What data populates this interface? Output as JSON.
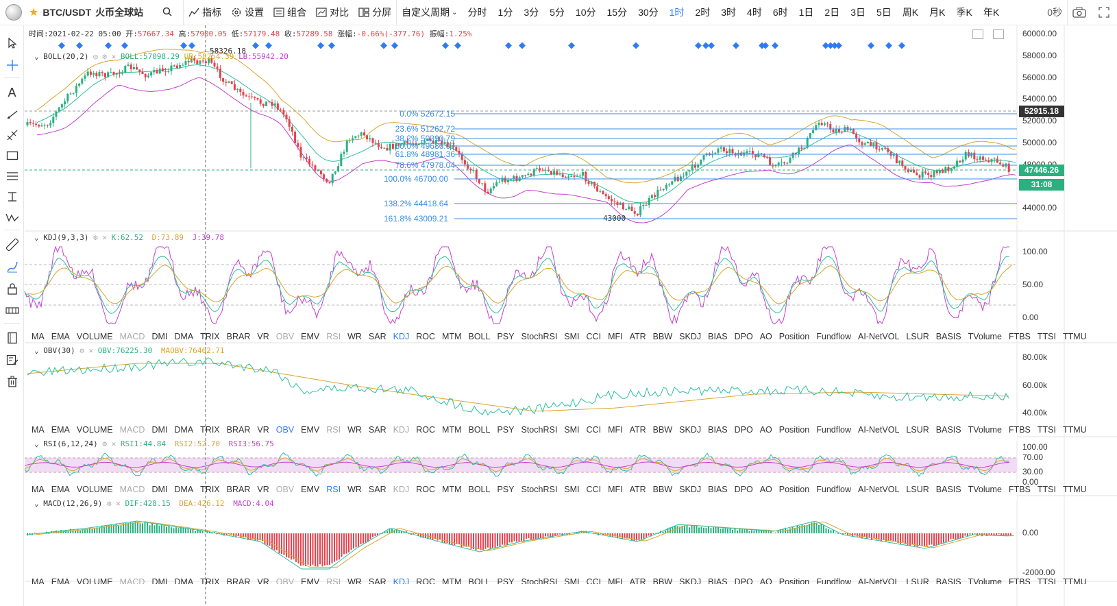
{
  "symbol": {
    "pair": "BTC/USDT",
    "exchange": "火币全球站"
  },
  "toolbar": {
    "indicators": "指标",
    "settings": "设置",
    "combo": "组合",
    "compare": "对比",
    "split": "分屏",
    "custom_period": "自定义周期",
    "periods": [
      "分时",
      "1分",
      "3分",
      "5分",
      "10分",
      "15分",
      "30分",
      "1时",
      "2时",
      "3时",
      "4时",
      "6时",
      "1日",
      "2日",
      "3日",
      "5日",
      "周K",
      "月K",
      "季K",
      "年K"
    ],
    "selected_period": "1时",
    "countdown": "0秒"
  },
  "ohlc": {
    "time_label": "时间:",
    "time": "2021-02-22 05:00",
    "open_label": "开:",
    "open": "57667.34",
    "high_label": "高:",
    "high": "57900.05",
    "low_label": "低:",
    "low": "57179.48",
    "close_label": "收:",
    "close": "57289.58",
    "change_label": "涨幅:",
    "change": "-0.66%(-377.76)",
    "amp_label": "振幅:",
    "amp": "1.25%"
  },
  "boll": {
    "name": "BOLL(20,2)",
    "mid": "BOLL:57098.29",
    "ub": "UB:58254.39",
    "lb": "LB:55942.20"
  },
  "main_axis": [
    "60000.00",
    "58000.00",
    "56000.00",
    "54000.00",
    "52000.00",
    "50000.00",
    "48000.00",
    "46000.00",
    "44000.00"
  ],
  "price_tags": {
    "high": "52915.18",
    "last": "47446.26",
    "timer": "31:08"
  },
  "peak_label": "58326.18",
  "low_label": "43000",
  "fib": [
    {
      "label": "0.0% 52672.15"
    },
    {
      "label": "23.6% 51262.72"
    },
    {
      "label": "38.2% 50390.79"
    },
    {
      "label": "50.0% 49686.07"
    },
    {
      "label": "61.8% 48981.36"
    },
    {
      "label": "78.6% 47978.04"
    },
    {
      "label": "100.0% 46700.00"
    },
    {
      "label": "138.2% 44418.64"
    },
    {
      "label": "161.8% 43009.21"
    }
  ],
  "kdj": {
    "name": "KDJ(9,3,3)",
    "k": "K:62.52",
    "d": "D:73.89",
    "j": "J:39.78",
    "axis": [
      "100.00",
      "50.00",
      "0.00"
    ]
  },
  "obv": {
    "name": "OBV(30)",
    "obv": "OBV:76225.30",
    "maobv": "MAOBV:76462.71",
    "axis": [
      "80.00k",
      "60.00k",
      "40.00k"
    ]
  },
  "rsi": {
    "name": "RSI(6,12,24)",
    "r1": "RSI1:44.84",
    "r2": "RSI2:52.70",
    "r3": "RSI3:56.75",
    "axis": [
      "100.00",
      "70.00",
      "30.00",
      "0.00"
    ]
  },
  "macd": {
    "name": "MACD(12,26,9)",
    "dif": "DIF:428.15",
    "dea": "DEA:426.12",
    "macd": "MACD:4.04",
    "axis": [
      "0.00",
      "-2000.00"
    ]
  },
  "indicator_tabs": [
    "MA",
    "EMA",
    "VOLUME",
    "MACD",
    "DMI",
    "DMA",
    "TRIX",
    "BRAR",
    "VR",
    "OBV",
    "EMV",
    "RSI",
    "WR",
    "SAR",
    "KDJ",
    "ROC",
    "MTM",
    "BOLL",
    "PSY",
    "StochRSI",
    "SMI",
    "CCI",
    "MFI",
    "ATR",
    "BBW",
    "SKDJ",
    "BIAS",
    "DPO",
    "AO",
    "Position",
    "Fundflow",
    "AI-NetVOL",
    "LSUR",
    "BASIS",
    "TVolume",
    "FTBS",
    "TTSI",
    "TTMU"
  ],
  "tab_state": {
    "row1": {
      "active": [
        "KDJ"
      ],
      "disabled": [
        "MACD",
        "OBV",
        "RSI"
      ]
    },
    "row2": {
      "active": [
        "OBV"
      ],
      "disabled": [
        "MACD",
        "RSI",
        "KDJ"
      ]
    },
    "row3": {
      "active": [
        "RSI"
      ],
      "disabled": [
        "MACD",
        "OBV",
        "KDJ"
      ]
    }
  },
  "colors": {
    "up": "#2bb07f",
    "down": "#e4424d",
    "accent": "#2f7bf7",
    "boll_mid": "#2bc0a0",
    "boll_up": "#d9a52c",
    "boll_low": "#c43fd0",
    "fib": "#3a8ee6"
  }
}
